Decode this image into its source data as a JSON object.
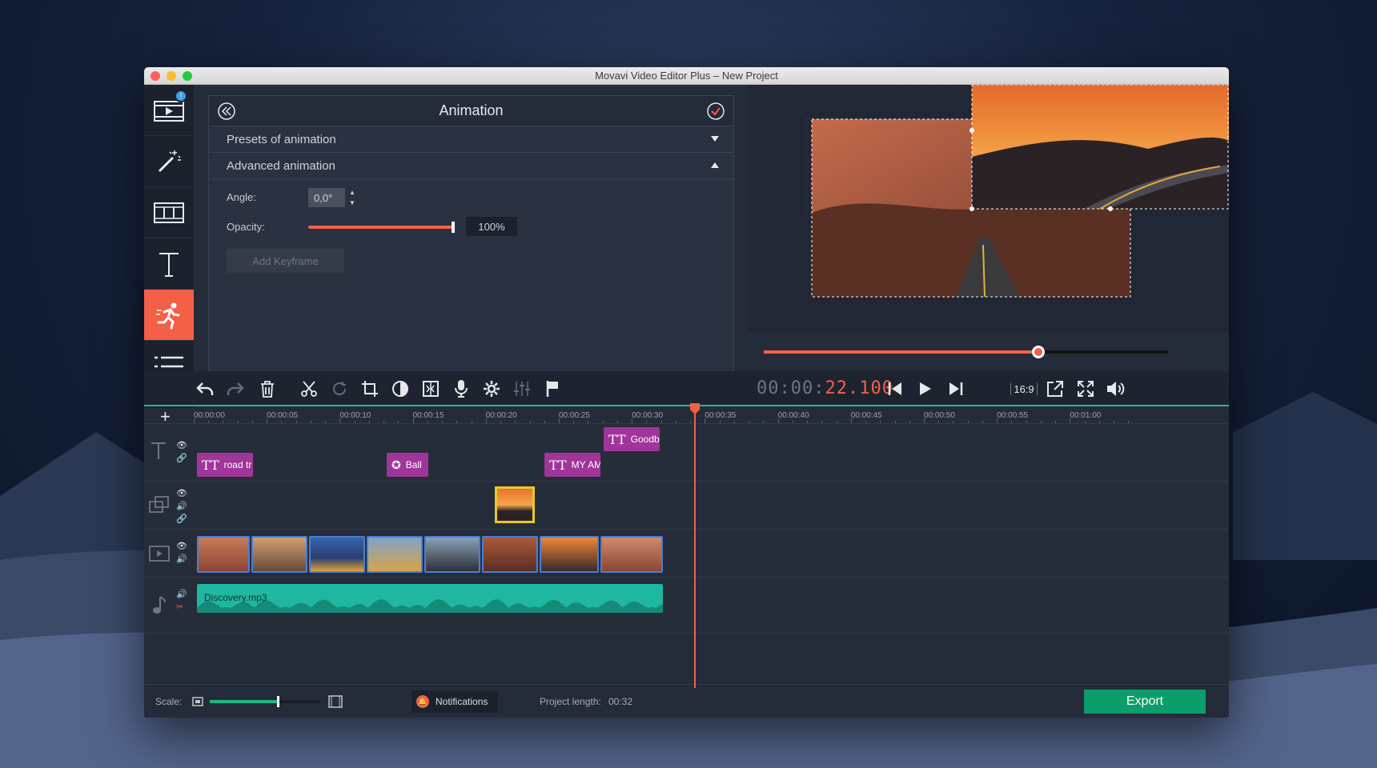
{
  "window": {
    "title": "Movavi Video Editor Plus – New Project"
  },
  "sidebar": {
    "badge": "!",
    "items": [
      "import",
      "filters",
      "transitions",
      "titles",
      "animation",
      "more"
    ]
  },
  "panel": {
    "title": "Animation",
    "sections": [
      {
        "label": "Presets of animation",
        "state": "collapsed"
      },
      {
        "label": "Advanced animation",
        "state": "expanded"
      }
    ],
    "angle_label": "Angle:",
    "angle_value": "0,0°",
    "opacity_label": "Opacity:",
    "opacity_value": "100%",
    "opacity_fraction": 1.0,
    "add_keyframe": "Add Keyframe"
  },
  "player": {
    "progress_fraction": 0.68,
    "timecode_dim": "00:00:",
    "timecode_accent": "22.100",
    "aspect": "16:9"
  },
  "ruler": {
    "ticks": [
      "00:00:00",
      "00:00:05",
      "00:00:10",
      "00:00:15",
      "00:00:20",
      "00:00:25",
      "00:00:30",
      "00:00:35",
      "00:00:40",
      "00:00:45",
      "00:00:50",
      "00:00:55",
      "00:01:00"
    ]
  },
  "timeline": {
    "titles": [
      {
        "label": "road tr"
      },
      {
        "label": "Ball"
      },
      {
        "label": "MY AM/"
      },
      {
        "label": "Goodby"
      }
    ],
    "audio_clip": "Discovery.mp3"
  },
  "footer": {
    "scale_label": "Scale:",
    "notifications": "Notifications",
    "project_length_label": "Project length:",
    "project_length_value": "00:32",
    "export": "Export"
  },
  "colors": {
    "accent": "#f45f47",
    "export": "#0c9d6c",
    "title_clip": "#a0359a",
    "audio": "#1fb7a0",
    "video_border": "#4a7fd6"
  }
}
